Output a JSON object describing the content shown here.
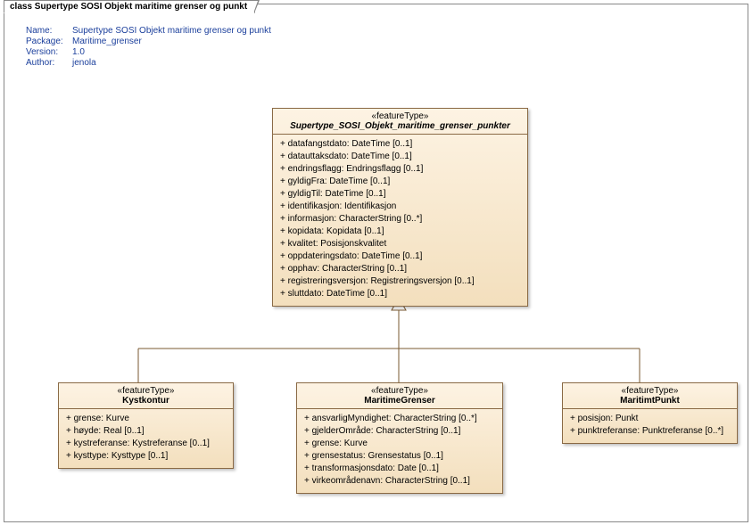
{
  "frame": {
    "label": "class Supertype SOSI Objekt maritime grenser og punkt"
  },
  "meta": {
    "name_label": "Name:",
    "name": "Supertype SOSI Objekt maritime grenser og punkt",
    "package_label": "Package:",
    "package": "Maritime_grenser",
    "version_label": "Version:",
    "version": "1.0",
    "author_label": "Author:",
    "author": "jenola"
  },
  "classes": {
    "super": {
      "stereotype": "«featureType»",
      "name": "Supertype_SOSI_Objekt_maritime_grenser_punkter",
      "attrs": [
        "datafangstdato: DateTime [0..1]",
        "datauttaksdato: DateTime [0..1]",
        "endringsflagg: Endringsflagg [0..1]",
        "gyldigFra: DateTime [0..1]",
        "gyldigTil: DateTime [0..1]",
        "identifikasjon: Identifikasjon",
        "informasjon: CharacterString [0..*]",
        "kopidata: Kopidata [0..1]",
        "kvalitet: Posisjonskvalitet",
        "oppdateringsdato: DateTime [0..1]",
        "opphav: CharacterString [0..1]",
        "registreringsversjon: Registreringsversjon [0..1]",
        "sluttdato: DateTime [0..1]"
      ]
    },
    "kyst": {
      "stereotype": "«featureType»",
      "name": "Kystkontur",
      "attrs": [
        "grense: Kurve",
        "høyde: Real [0..1]",
        "kystreferanse: Kystreferanse [0..1]",
        "kysttype: Kysttype [0..1]"
      ]
    },
    "maritime": {
      "stereotype": "«featureType»",
      "name": "MaritimeGrenser",
      "attrs": [
        "ansvarligMyndighet: CharacterString [0..*]",
        "gjelderOmråde: CharacterString [0..1]",
        "grense: Kurve",
        "grensestatus: Grensestatus [0..1]",
        "transformasjonsdato: Date [0..1]",
        "virkeområdenavn: CharacterString [0..1]"
      ]
    },
    "punkt": {
      "stereotype": "«featureType»",
      "name": "MaritimtPunkt",
      "attrs": [
        "posisjon: Punkt",
        "punktreferanse: Punktreferanse [0..*]"
      ]
    }
  }
}
